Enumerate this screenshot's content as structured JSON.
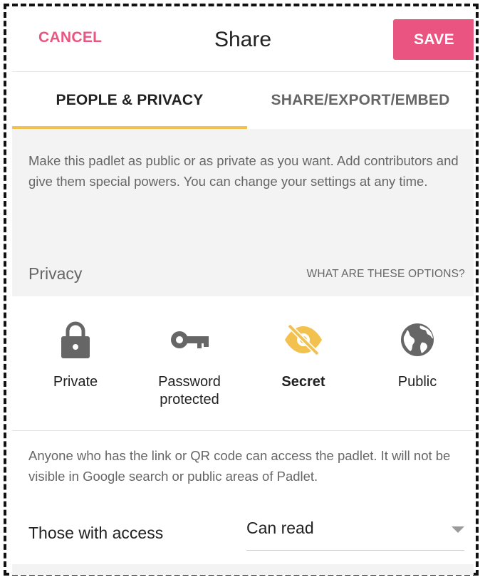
{
  "header": {
    "cancel_label": "CANCEL",
    "title": "Share",
    "save_label": "SAVE"
  },
  "tabs": [
    {
      "label": "PEOPLE & PRIVACY",
      "active": true
    },
    {
      "label": "SHARE/EXPORT/EMBED",
      "active": false
    }
  ],
  "intro": {
    "text": "Make this padlet as public or as private as you want. Add contributors and give them special powers. You can change your settings at any time."
  },
  "privacy": {
    "label": "Privacy",
    "help_link": "WHAT ARE THESE OPTIONS?",
    "options": [
      {
        "label": "Private",
        "icon": "lock-icon",
        "selected": false
      },
      {
        "label": "Password protected",
        "icon": "key-icon",
        "selected": false
      },
      {
        "label": "Secret",
        "icon": "eye-off-icon",
        "selected": true
      },
      {
        "label": "Public",
        "icon": "globe-icon",
        "selected": false
      }
    ],
    "description": "Anyone who has the link or QR code can access the padlet. It will not be visible in Google search or public areas of Padlet."
  },
  "access": {
    "label": "Those with access",
    "value": "Can read"
  },
  "colors": {
    "accent_pink": "#ea5480",
    "tab_indicator": "#f2c14e",
    "selected_icon": "#f2c14e",
    "icon_grey": "#666666"
  }
}
